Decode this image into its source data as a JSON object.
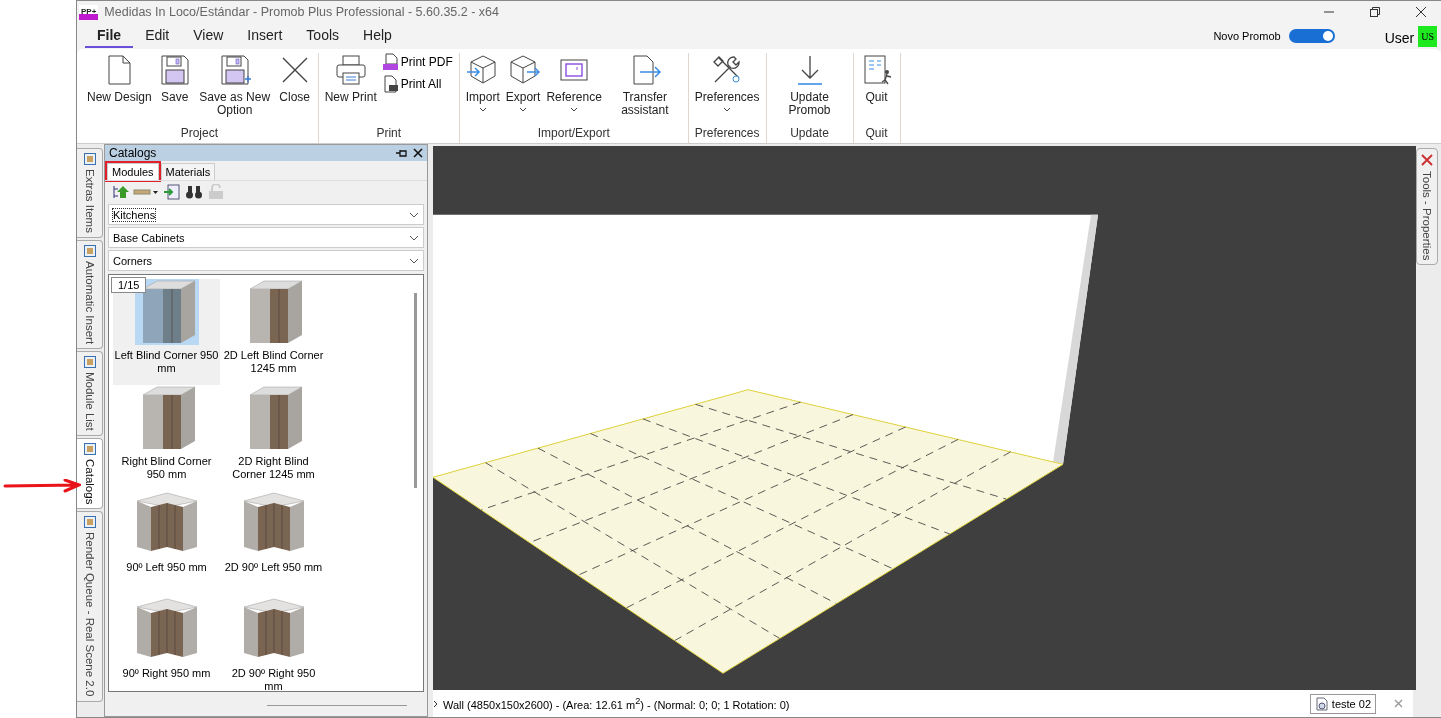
{
  "window": {
    "title": "Medidas In Loco/Estándar - Promob Plus Professional - 5.60.35.2 - x64",
    "logo": "PP+"
  },
  "menu": [
    {
      "label": "File",
      "selected": true
    },
    {
      "label": "Edit",
      "selected": false
    },
    {
      "label": "View",
      "selected": false
    },
    {
      "label": "Insert",
      "selected": false
    },
    {
      "label": "Tools",
      "selected": false
    },
    {
      "label": "Help",
      "selected": false
    }
  ],
  "toggle": {
    "label": "Novo Promob",
    "on": true
  },
  "user": {
    "label": "User",
    "initials": "US"
  },
  "ribbon": [
    {
      "label": "Project",
      "buttons": [
        {
          "label": "New Design",
          "kind": "large"
        },
        {
          "label": "Save",
          "kind": "large"
        },
        {
          "label": "Save as New Option",
          "kind": "large"
        },
        {
          "label": "Close",
          "kind": "large"
        }
      ]
    },
    {
      "label": "Print",
      "buttons": [
        {
          "label": "New Print",
          "kind": "large"
        },
        {
          "label": "Print PDF",
          "kind": "small"
        },
        {
          "label": "Print All",
          "kind": "small"
        }
      ]
    },
    {
      "label": "Import/Export",
      "buttons": [
        {
          "label": "Import",
          "kind": "large",
          "dropdown": true
        },
        {
          "label": "Export",
          "kind": "large",
          "dropdown": true
        },
        {
          "label": "Reference",
          "kind": "large",
          "dropdown": true
        },
        {
          "label": "Transfer assistant",
          "kind": "large",
          "dropdown": false
        }
      ]
    },
    {
      "label": "Preferences",
      "buttons": [
        {
          "label": "Preferences",
          "kind": "large",
          "dropdown": true
        }
      ]
    },
    {
      "label": "Update",
      "buttons": [
        {
          "label": "Update Promob",
          "kind": "large",
          "dropdown": false
        }
      ]
    },
    {
      "label": "Quit",
      "buttons": [
        {
          "label": "Quit",
          "kind": "large",
          "dropdown": false
        }
      ]
    }
  ],
  "side_tabs": [
    {
      "label": "Extras Items",
      "selected": false
    },
    {
      "label": "Automatic Insert",
      "selected": false
    },
    {
      "label": "Module List",
      "selected": false
    },
    {
      "label": "Catalogs",
      "selected": true
    },
    {
      "label": "Render Queue - Real Scene 2.0",
      "selected": false
    }
  ],
  "catalogs": {
    "title": "Catalogs",
    "tabs": [
      {
        "label": "Modules",
        "selected": true
      },
      {
        "label": "Materials",
        "selected": false
      }
    ],
    "dropdowns": [
      "Kitchens",
      "Base Cabinets",
      "Corners"
    ],
    "page": "1/15",
    "items": [
      {
        "label": "Left Blind Corner 950 mm",
        "kind": "blind",
        "selected": true
      },
      {
        "label": "2D Left Blind Corner 1245 mm",
        "kind": "blind",
        "selected": false
      },
      {
        "label": "Right Blind Corner 950 mm",
        "kind": "blind",
        "selected": false
      },
      {
        "label": "2D Right Blind Corner 1245 mm",
        "kind": "blind",
        "selected": false
      },
      {
        "label": "90º Left 950 mm",
        "kind": "corner",
        "selected": false
      },
      {
        "label": "2D 90º Left 950 mm",
        "kind": "corner",
        "selected": false
      },
      {
        "label": "90º Right 950 mm",
        "kind": "corner",
        "selected": false
      },
      {
        "label": "2D 90º Right 950 mm",
        "kind": "corner",
        "selected": false
      }
    ]
  },
  "right_tabs": [
    {
      "label": "Tools - Properties",
      "selected": false
    }
  ],
  "status": {
    "text": "Wall (4850x150x2600) - (Area: 12.61 m$^{2}$) - (Normal: 0; 0; 1 Rotation: 0)",
    "document_tab": "teste 02"
  }
}
